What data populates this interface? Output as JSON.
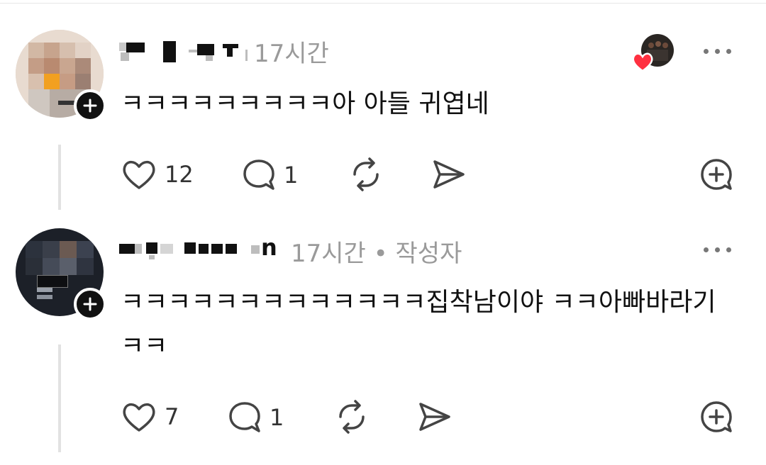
{
  "posts": [
    {
      "time": "17시간",
      "author_suffix": "",
      "author_badge": "",
      "text_lines": [
        "ㅋㅋㅋㅋㅋㅋㅋㅋㅋ아 아들 귀엽네"
      ],
      "likes": "12",
      "replies": "1",
      "liked_by_author": true
    },
    {
      "time": "17시간",
      "author_suffix": "n",
      "author_badge": "• 작성자",
      "text_lines": [
        "ㅋㅋㅋㅋㅋㅋㅋㅋㅋㅋㅋㅋㅋ집착남이야 ㅋㅋ아빠바라기",
        "ㅋㅋ"
      ],
      "likes": "7",
      "replies": "1",
      "liked_by_author": false
    }
  ],
  "icons": {
    "like": "heart-outline-icon",
    "reply": "speech-bubble-icon",
    "repost": "repost-arrows-icon",
    "share": "send-arrow-icon",
    "add": "plus-circle-icon",
    "more": "ellipsis-icon",
    "follow": "plus-icon",
    "liked_heart": "heart-filled-icon"
  },
  "colors": {
    "text": "#111111",
    "meta": "#9a9a9a",
    "icon": "#444444",
    "liked_heart": "#ff3040"
  }
}
